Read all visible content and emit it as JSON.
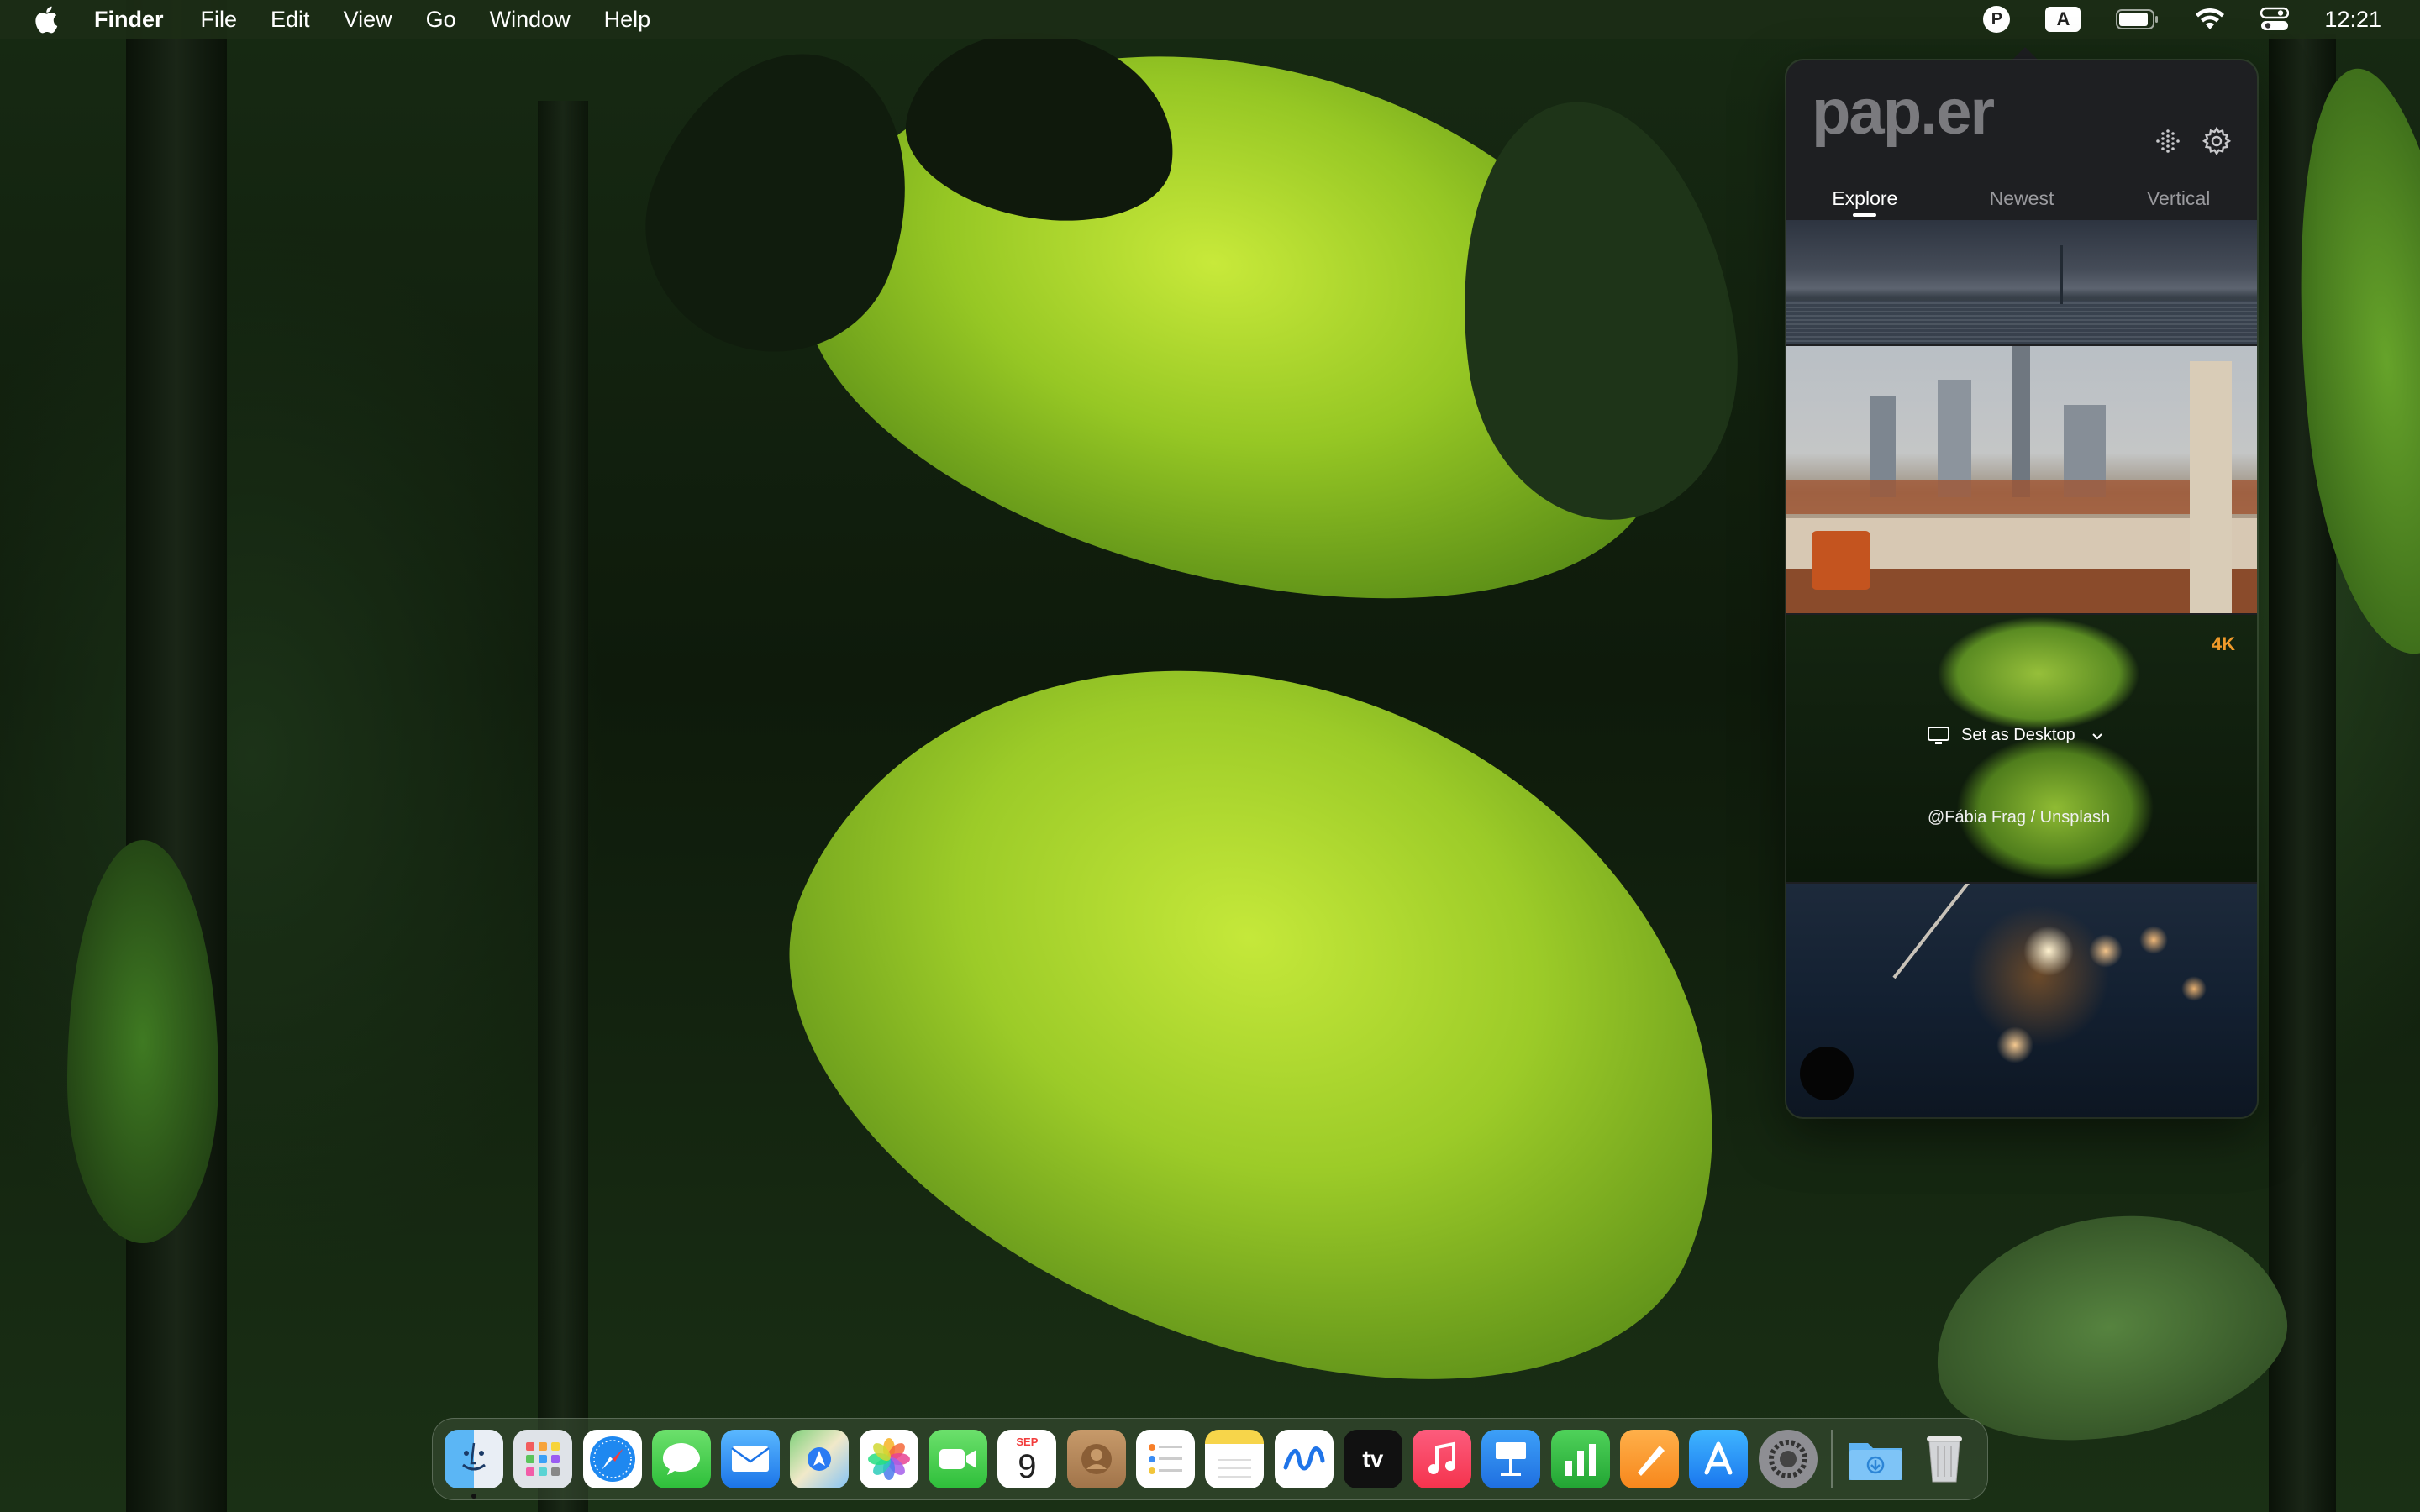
{
  "menubar": {
    "app_name": "Finder",
    "menus": [
      "File",
      "Edit",
      "View",
      "Go",
      "Window",
      "Help"
    ],
    "status_icons": [
      "paper-icon",
      "input-source-icon",
      "battery-icon",
      "wifi-icon",
      "control-center-icon"
    ],
    "input_source_label": "A",
    "paper_icon_label": "P",
    "clock": "12:21"
  },
  "popover": {
    "logo": "pap.er",
    "tabs": [
      "Explore",
      "Newest",
      "Vertical"
    ],
    "active_tab": "Explore",
    "wallpapers": [
      {
        "name": "stormy-sea"
      },
      {
        "name": "city-rooftop"
      },
      {
        "name": "green-leaves",
        "badge": "4K",
        "action_label": "Set as Desktop",
        "credit": "@Fábia Frag / Unsplash"
      },
      {
        "name": "sparkler-night"
      }
    ],
    "accent_color": "#f09a2a"
  },
  "dock": {
    "apps": [
      "Finder",
      "Launchpad",
      "Safari",
      "Messages",
      "Mail",
      "Maps",
      "Photos",
      "FaceTime",
      "Calendar",
      "Contacts",
      "Reminders",
      "Notes",
      "Freeform",
      "TV",
      "Music",
      "Keynote",
      "Numbers",
      "Pages",
      "App Store",
      "System Settings"
    ],
    "calendar_month": "SEP",
    "calendar_day": "9",
    "tv_label": "tv",
    "extras": [
      "Downloads",
      "Trash"
    ]
  }
}
